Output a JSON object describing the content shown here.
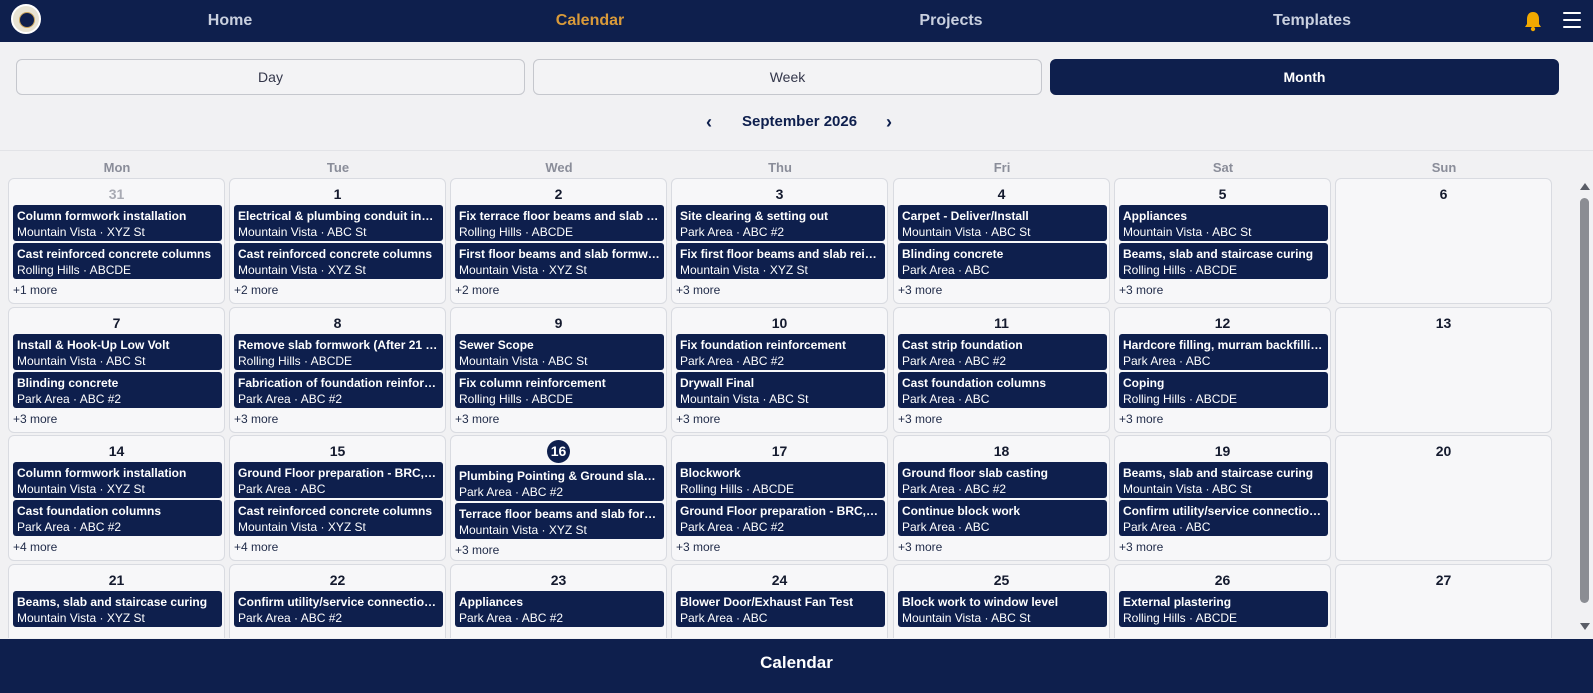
{
  "nav": {
    "home": "Home",
    "calendar": "Calendar",
    "projects": "Projects",
    "templates": "Templates",
    "bell_icon": "bell-icon",
    "menu_icon": "hamburger-menu-icon"
  },
  "views": {
    "day": "Day",
    "week": "Week",
    "month": "Month",
    "selected": "Month"
  },
  "month_nav": {
    "prev": "‹",
    "label": "September 2026",
    "next": "›"
  },
  "weekdays": [
    "Mon",
    "Tue",
    "Wed",
    "Thu",
    "Fri",
    "Sat",
    "Sun"
  ],
  "weeks": [
    [
      {
        "day": "31",
        "muted": true,
        "events": [
          {
            "title": "Column formwork installation",
            "sub": "Mountain Vista · XYZ St"
          },
          {
            "title": "Cast reinforced concrete columns",
            "sub": "Rolling Hills · ABCDE"
          }
        ],
        "more": "+1 more"
      },
      {
        "day": "1",
        "events": [
          {
            "title": "Electrical & plumbing conduit insta...",
            "sub": "Mountain Vista · ABC St"
          },
          {
            "title": "Cast reinforced concrete columns",
            "sub": "Mountain Vista · XYZ St"
          }
        ],
        "more": "+2 more"
      },
      {
        "day": "2",
        "events": [
          {
            "title": "Fix terrace floor beams and slab rei...",
            "sub": "Rolling Hills · ABCDE"
          },
          {
            "title": "First floor beams and slab formwork",
            "sub": "Mountain Vista · XYZ St"
          }
        ],
        "more": "+2 more"
      },
      {
        "day": "3",
        "events": [
          {
            "title": "Site clearing & setting out",
            "sub": "Park Area · ABC #2"
          },
          {
            "title": "Fix first floor beams and slab reinfo...",
            "sub": "Mountain Vista · XYZ St"
          }
        ],
        "more": "+3 more"
      },
      {
        "day": "4",
        "events": [
          {
            "title": "Carpet - Deliver/Install",
            "sub": "Mountain Vista · ABC St"
          },
          {
            "title": "Blinding concrete",
            "sub": "Park Area · ABC"
          }
        ],
        "more": "+3 more"
      },
      {
        "day": "5",
        "events": [
          {
            "title": "Appliances",
            "sub": "Mountain Vista · ABC St"
          },
          {
            "title": "Beams, slab and staircase curing",
            "sub": "Rolling Hills · ABCDE"
          }
        ],
        "more": "+3 more"
      },
      {
        "day": "6",
        "events": [],
        "more": ""
      }
    ],
    [
      {
        "day": "7",
        "events": [
          {
            "title": "Install & Hook-Up Low Volt",
            "sub": "Mountain Vista · ABC St"
          },
          {
            "title": "Blinding concrete",
            "sub": "Park Area · ABC #2"
          }
        ],
        "more": "+3 more"
      },
      {
        "day": "8",
        "events": [
          {
            "title": "Remove slab formwork (After 21 da...",
            "sub": "Rolling Hills · ABCDE"
          },
          {
            "title": "Fabrication of foundation reinforce...",
            "sub": "Park Area · ABC #2"
          }
        ],
        "more": "+3 more"
      },
      {
        "day": "9",
        "events": [
          {
            "title": "Sewer Scope",
            "sub": "Mountain Vista · ABC St"
          },
          {
            "title": "Fix column reinforcement",
            "sub": "Rolling Hills · ABCDE"
          }
        ],
        "more": "+3 more"
      },
      {
        "day": "10",
        "events": [
          {
            "title": "Fix foundation reinforcement",
            "sub": "Park Area · ABC #2"
          },
          {
            "title": "Drywall Final",
            "sub": "Mountain Vista · ABC St"
          }
        ],
        "more": "+3 more"
      },
      {
        "day": "11",
        "events": [
          {
            "title": "Cast strip foundation",
            "sub": "Park Area · ABC #2"
          },
          {
            "title": "Cast foundation columns",
            "sub": "Park Area · ABC"
          }
        ],
        "more": "+3 more"
      },
      {
        "day": "12",
        "events": [
          {
            "title": "Hardcore filling, murram backfillin...",
            "sub": "Park Area · ABC"
          },
          {
            "title": "Coping",
            "sub": "Rolling Hills · ABCDE"
          }
        ],
        "more": "+3 more"
      },
      {
        "day": "13",
        "events": [],
        "more": ""
      }
    ],
    [
      {
        "day": "14",
        "events": [
          {
            "title": "Column formwork installation",
            "sub": "Mountain Vista · XYZ St"
          },
          {
            "title": "Cast foundation columns",
            "sub": "Park Area · ABC #2"
          }
        ],
        "more": "+4 more"
      },
      {
        "day": "15",
        "events": [
          {
            "title": "Ground Floor preparation - BRC, D...",
            "sub": "Park Area · ABC"
          },
          {
            "title": "Cast reinforced concrete columns",
            "sub": "Mountain Vista · XYZ St"
          }
        ],
        "more": "+4 more"
      },
      {
        "day": "16",
        "today": true,
        "events": [
          {
            "title": "Plumbing Pointing & Ground slab f...",
            "sub": "Park Area · ABC #2"
          },
          {
            "title": "Terrace floor beams and slab form...",
            "sub": "Mountain Vista · XYZ St"
          }
        ],
        "more": "+3 more"
      },
      {
        "day": "17",
        "events": [
          {
            "title": "Blockwork",
            "sub": "Rolling Hills · ABCDE"
          },
          {
            "title": "Ground Floor preparation - BRC, D...",
            "sub": "Park Area · ABC #2"
          }
        ],
        "more": "+3 more"
      },
      {
        "day": "18",
        "events": [
          {
            "title": "Ground floor slab casting",
            "sub": "Park Area · ABC #2"
          },
          {
            "title": "Continue block work",
            "sub": "Park Area · ABC"
          }
        ],
        "more": "+3 more"
      },
      {
        "day": "19",
        "events": [
          {
            "title": "Beams, slab and staircase curing",
            "sub": "Mountain Vista · ABC St"
          },
          {
            "title": "Confirm utility/service connection ...",
            "sub": "Park Area · ABC"
          }
        ],
        "more": "+3 more"
      },
      {
        "day": "20",
        "events": [],
        "more": ""
      }
    ],
    [
      {
        "day": "21",
        "events": [
          {
            "title": "Beams, slab and staircase curing",
            "sub": "Mountain Vista · XYZ St"
          }
        ],
        "more": ""
      },
      {
        "day": "22",
        "events": [
          {
            "title": "Confirm utility/service connection ...",
            "sub": "Park Area · ABC #2"
          }
        ],
        "more": ""
      },
      {
        "day": "23",
        "events": [
          {
            "title": "Appliances",
            "sub": "Park Area · ABC #2"
          }
        ],
        "more": ""
      },
      {
        "day": "24",
        "events": [
          {
            "title": "Blower Door/Exhaust Fan Test",
            "sub": "Park Area · ABC"
          }
        ],
        "more": ""
      },
      {
        "day": "25",
        "events": [
          {
            "title": "Block work to window level",
            "sub": "Mountain Vista · ABC St"
          }
        ],
        "more": ""
      },
      {
        "day": "26",
        "events": [
          {
            "title": "External plastering",
            "sub": "Rolling Hills · ABCDE"
          }
        ],
        "more": ""
      },
      {
        "day": "27",
        "events": [],
        "more": ""
      }
    ]
  ],
  "footer": {
    "label": "Calendar"
  },
  "colors": {
    "navy": "#0e1f4d",
    "accent": "#d99a3a",
    "background": "#f1f1f3"
  }
}
